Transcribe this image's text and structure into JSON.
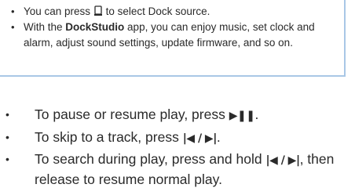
{
  "note": {
    "items": [
      {
        "before": "You can press ",
        "icon": "dock-source-icon",
        "after": " to select Dock source."
      },
      {
        "before": "With the ",
        "bold": "DockStudio",
        "after": " app, you can enjoy music, set clock and alarm, adjust sound settings, update firmware, and so on."
      }
    ],
    "border_color": "#a9c7e6"
  },
  "steps": [
    {
      "text": "To pause or resume play, press ",
      "control": "▶❚❚",
      "end": "."
    },
    {
      "text": "To skip to a track, press ",
      "control": "|◀ / ▶|",
      "end": "."
    },
    {
      "text": "To search during play, press and hold ",
      "control": "|◀ / ▶|",
      "end": ", then release to resume normal play."
    }
  ],
  "bullet": "•"
}
